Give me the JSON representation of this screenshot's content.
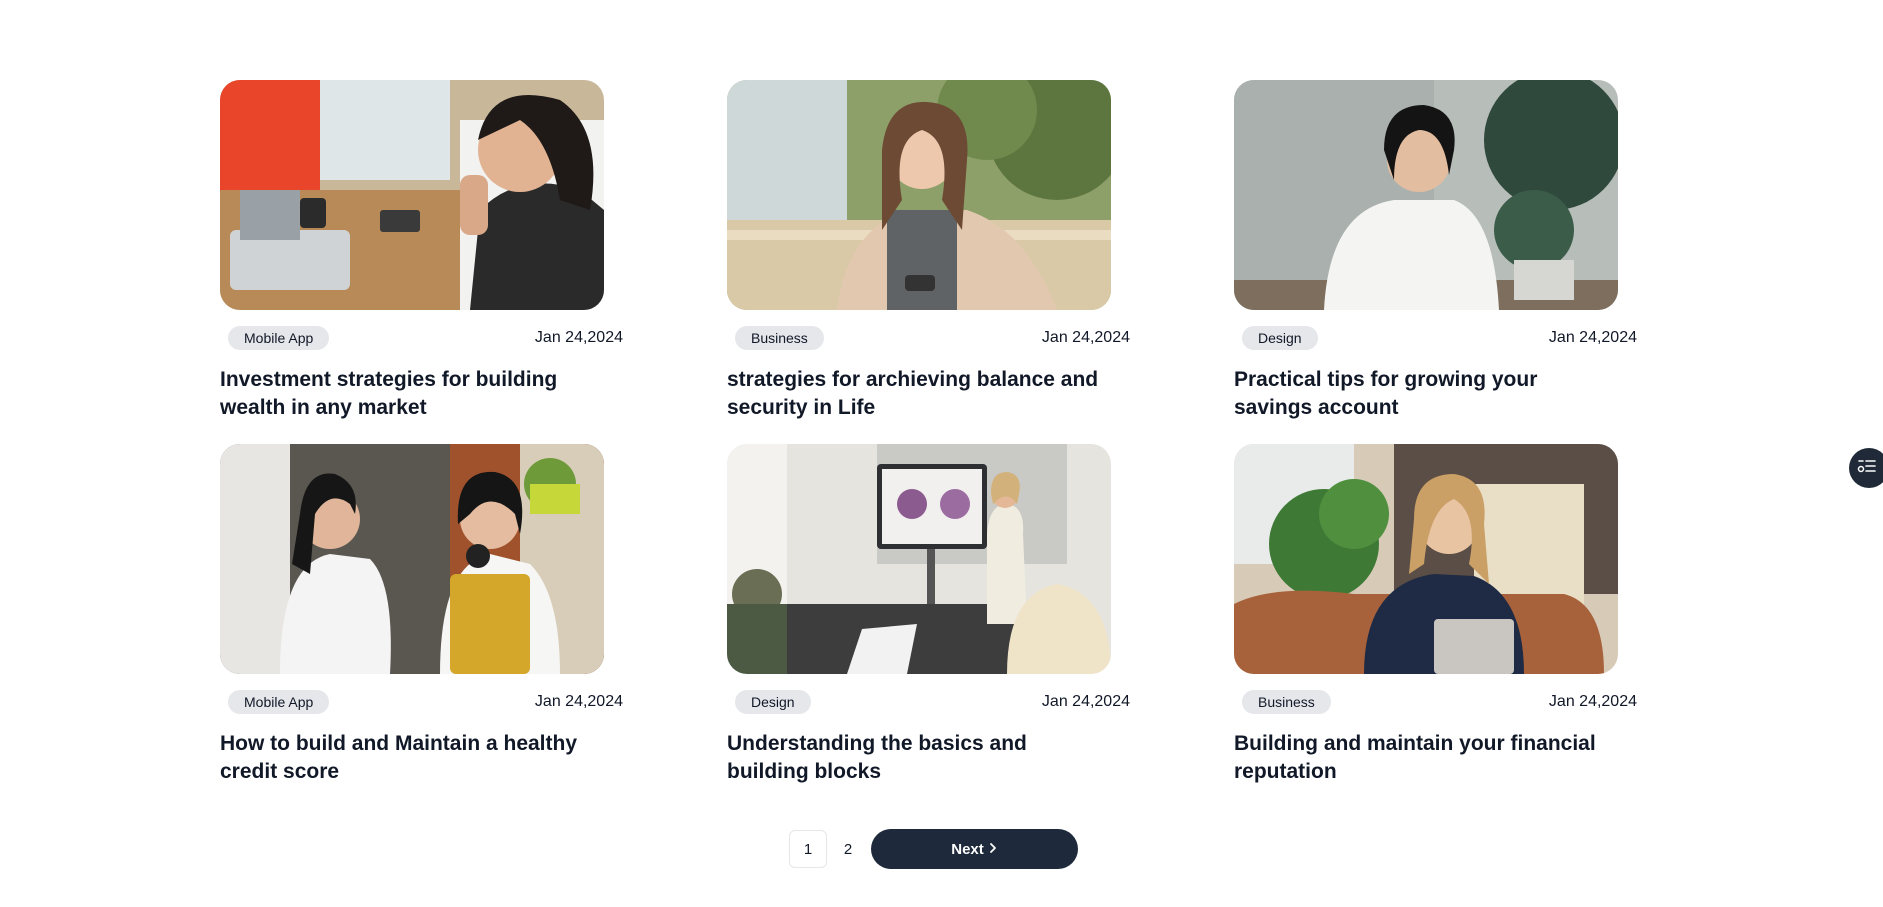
{
  "posts": [
    {
      "tag": "Mobile App",
      "date": "Jan 24,2024",
      "title": "Investment strategies for building wealth in any market",
      "image": "woman-on-phone-at-desk"
    },
    {
      "tag": "Business",
      "date": "Jan 24,2024",
      "title": "strategies for archieving balance and security in Life",
      "image": "woman-smiling-outdoors"
    },
    {
      "tag": "Design",
      "date": "Jan 24,2024",
      "title": "Practical tips for growing your savings account",
      "image": "woman-working-on-laptop"
    },
    {
      "tag": "Mobile App",
      "date": "Jan 24,2024",
      "title": "How to build and Maintain a healthy credit score",
      "image": "two-women-talking-office"
    },
    {
      "tag": "Design",
      "date": "Jan 24,2024",
      "title": "Understanding the basics and building blocks",
      "image": "presentation-meeting"
    },
    {
      "tag": "Business",
      "date": "Jan 24,2024",
      "title": "Building and maintain your financial reputation",
      "image": "woman-on-phone-on-sofa"
    }
  ],
  "pagination": {
    "pages": [
      "1",
      "2"
    ],
    "current": "1",
    "next_label": "Next"
  },
  "floating": {
    "icon": "settings-list-icon"
  }
}
